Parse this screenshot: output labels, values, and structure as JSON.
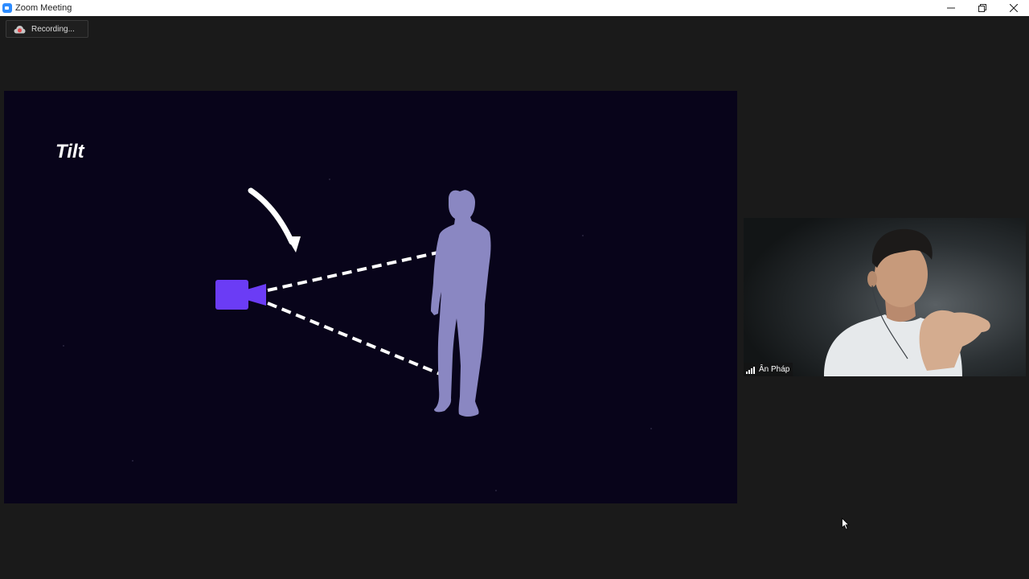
{
  "window": {
    "title": "Zoom Meeting",
    "controls": [
      "minimize",
      "restore",
      "close"
    ]
  },
  "recording": {
    "label": "Recording...",
    "icon": "cloud-recording-icon"
  },
  "shared_screen": {
    "slide_title": "Tilt",
    "illustration": [
      "camera-icon",
      "curved-arrow",
      "dashed-view-lines",
      "person-silhouette"
    ],
    "colors": {
      "background": "#08041a",
      "camera": "#6b3cf5",
      "person": "#8a87c2"
    }
  },
  "participant": {
    "name": "Ân Pháp",
    "icon": "signal-strength-icon"
  }
}
